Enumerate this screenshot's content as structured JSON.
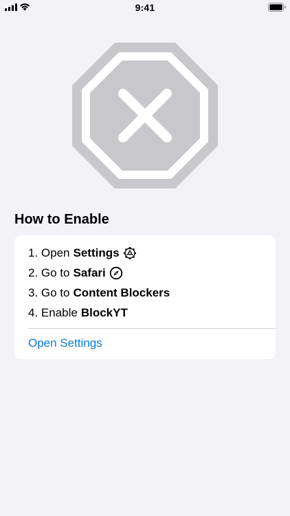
{
  "status_bar": {
    "time": "9:41"
  },
  "hero": {
    "icon": "xmark-octagon-icon",
    "color": "#C8C8CC"
  },
  "section": {
    "title": "How to Enable"
  },
  "steps": [
    {
      "prefix": "1. Open",
      "bold": "Settings",
      "icon": "gear-icon"
    },
    {
      "prefix": "2. Go to",
      "bold": "Safari",
      "icon": "compass-icon"
    },
    {
      "prefix": "3. Go to",
      "bold": "Content Blockers"
    },
    {
      "prefix": "4. Enable",
      "bold": "BlockYT"
    }
  ],
  "action": {
    "open_settings_label": "Open Settings",
    "color": "#0A7AD6"
  }
}
